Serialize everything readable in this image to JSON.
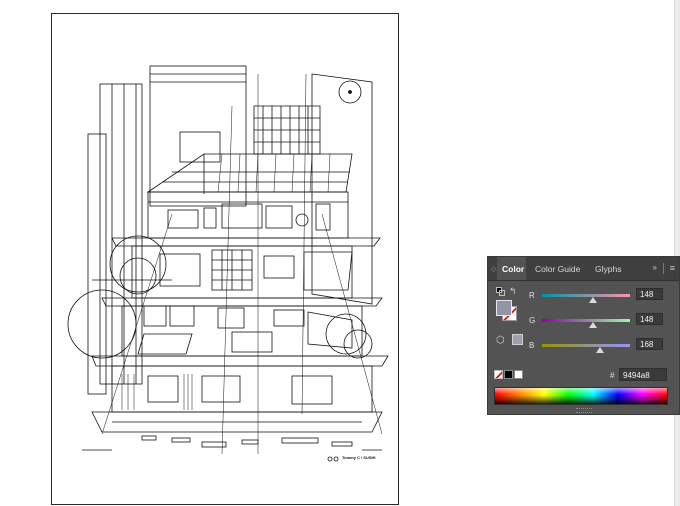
{
  "color_panel": {
    "tabs": [
      {
        "label": "Color",
        "active": true
      },
      {
        "label": "Color Guide",
        "active": false
      },
      {
        "label": "Glyphs",
        "active": false
      }
    ],
    "collapse_icon": "double-chevron-right",
    "menu_icon": "hamburger-menu",
    "fill_color": "#9494a8",
    "stroke_color": "none",
    "channels": [
      {
        "label": "R",
        "value": "148",
        "fraction": 0.58
      },
      {
        "label": "G",
        "value": "148",
        "fraction": 0.58
      },
      {
        "label": "B",
        "value": "168",
        "fraction": 0.66
      }
    ],
    "hash_symbol": "#",
    "hex_value": "9494a8",
    "swatches": [
      "none",
      "#000000",
      "#ffffff"
    ]
  },
  "artboard": {
    "signature": "Tommy C / SUSHI"
  }
}
